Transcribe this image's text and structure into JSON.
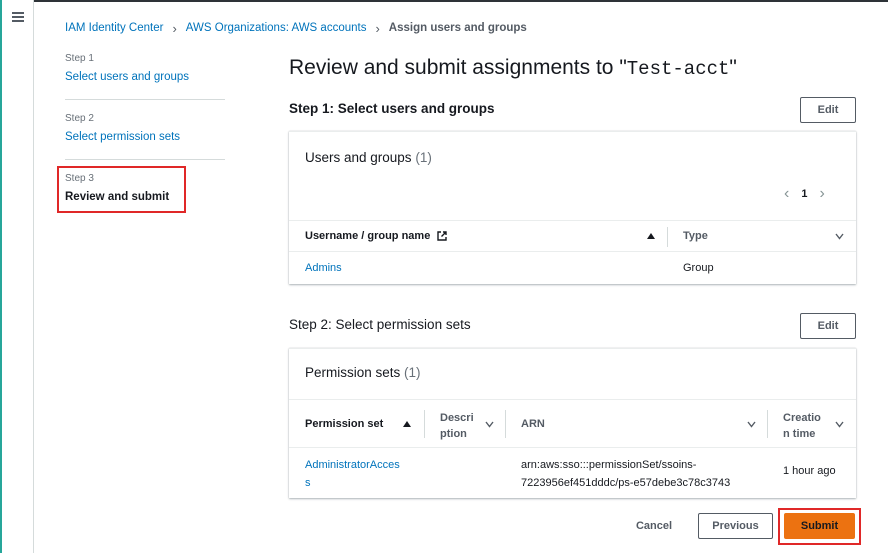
{
  "breadcrumb": {
    "items": [
      {
        "label": "IAM Identity Center"
      },
      {
        "label": "AWS Organizations: AWS accounts"
      }
    ],
    "current": "Assign users and groups"
  },
  "steps": [
    {
      "number": "Step 1",
      "label": "Select users and groups"
    },
    {
      "number": "Step 2",
      "label": "Select permission sets"
    },
    {
      "number": "Step 3",
      "label": "Review and submit"
    }
  ],
  "page": {
    "title_prefix": "Review and submit assignments to \"",
    "account": "Test-acct",
    "title_suffix": "\""
  },
  "step1": {
    "heading": "Step 1: Select users and groups",
    "edit_label": "Edit",
    "panel": {
      "title": "Users and groups",
      "count": "(1)",
      "page_number": "1",
      "columns": [
        "Username / group name",
        "Type"
      ],
      "rows": [
        {
          "name": "Admins",
          "type": "Group"
        }
      ]
    }
  },
  "step2": {
    "heading": "Step 2: Select permission sets",
    "edit_label": "Edit",
    "panel": {
      "title": "Permission sets",
      "count": "(1)",
      "columns": {
        "permission_set": "Permission set",
        "description_line1": "Descri",
        "description_line2": "ption",
        "arn": "ARN",
        "creation_line1": "Creatio",
        "creation_line2": "n time"
      },
      "rows": [
        {
          "name_line1": "AdministratorAcces",
          "name_line2": "s",
          "arn_line1": "arn:aws:sso:::permissionSet/ssoins-",
          "arn_line2": "7223956ef451dddc/ps-e57debe3c78c3743",
          "created": "1 hour ago"
        }
      ]
    }
  },
  "footer": {
    "cancel": "Cancel",
    "previous": "Previous",
    "submit": "Submit"
  },
  "icons": {
    "menu": "hamburger-menu-icon",
    "external_link": "external-link-icon",
    "sort_asc": "caret-up-icon",
    "sort_desc": "caret-down-icon",
    "prev_page": "chevron-left-icon",
    "next_page": "chevron-right-icon"
  },
  "colors": {
    "link": "#0073bb",
    "primary_button": "#ec7211",
    "highlight_box": "#e02828"
  }
}
